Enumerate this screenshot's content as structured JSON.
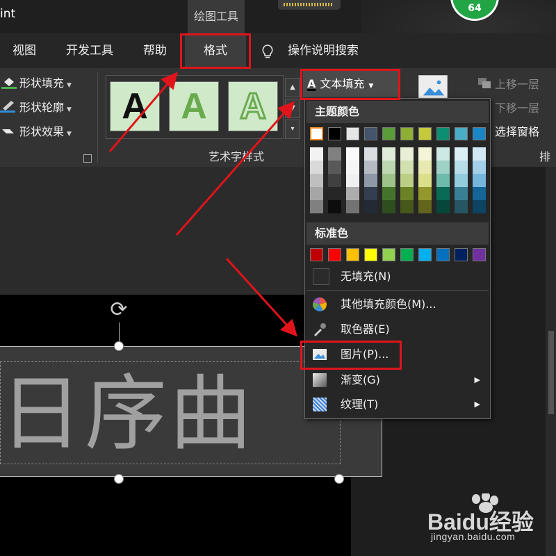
{
  "titlebar": {
    "app_name_fragment": "int",
    "context_title": "绘图工具",
    "account_badge": "64"
  },
  "tabs": [
    {
      "label": "视图",
      "active": false
    },
    {
      "label": "开发工具",
      "active": false
    },
    {
      "label": "帮助",
      "active": false
    },
    {
      "label": "格式",
      "active": true
    }
  ],
  "tell_me": {
    "label": "操作说明搜索"
  },
  "ribbon": {
    "shape_styles": {
      "fill": "形状填充",
      "outline": "形状轮廓",
      "effects": "形状效果"
    },
    "wordart": {
      "group_label": "艺术字样式",
      "sample_letter": "A",
      "text_fill": "文本填充",
      "text_fill_icon_letter": "A"
    },
    "arrange": {
      "bring_forward": "上移一层",
      "send_backward": "下移一层",
      "selection_pane": "选择窗格",
      "group_label_fragment": "排列"
    }
  },
  "dropdown": {
    "theme_colors_title": "主题颜色",
    "standard_colors_title": "标准色",
    "theme_colors": [
      "#ffffff",
      "#000000",
      "#e7e6e6",
      "#44546a",
      "#5b9b3a",
      "#8eaf34",
      "#c5c93a",
      "#0c8e73",
      "#4bacc6",
      "#1a86c6"
    ],
    "standard_colors": [
      "#c00000",
      "#ff0000",
      "#ffc000",
      "#ffff00",
      "#92d050",
      "#00b050",
      "#00b0f0",
      "#0070c0",
      "#002060",
      "#7030a0"
    ],
    "items": [
      {
        "label": "无填充(N)",
        "icon": "no-fill-icon",
        "submenu": false
      },
      {
        "label": "其他填充颜色(M)...",
        "icon": "color-wheel-icon",
        "submenu": false
      },
      {
        "label": "取色器(E)",
        "icon": "eyedropper-icon",
        "submenu": false
      },
      {
        "label": "图片(P)...",
        "icon": "picture-icon",
        "submenu": false
      },
      {
        "label": "渐变(G)",
        "icon": "gradient-icon",
        "submenu": true
      },
      {
        "label": "纹理(T)",
        "icon": "texture-icon",
        "submenu": true
      }
    ]
  },
  "slide": {
    "textbox_text": "日序曲"
  },
  "watermark": {
    "logo": "Baidu经验",
    "url": "jingyan.baidu.com"
  },
  "colors": {
    "highlight": "#e0141a",
    "ribbon_bg": "#333333",
    "dropdown_bg": "#262626"
  }
}
